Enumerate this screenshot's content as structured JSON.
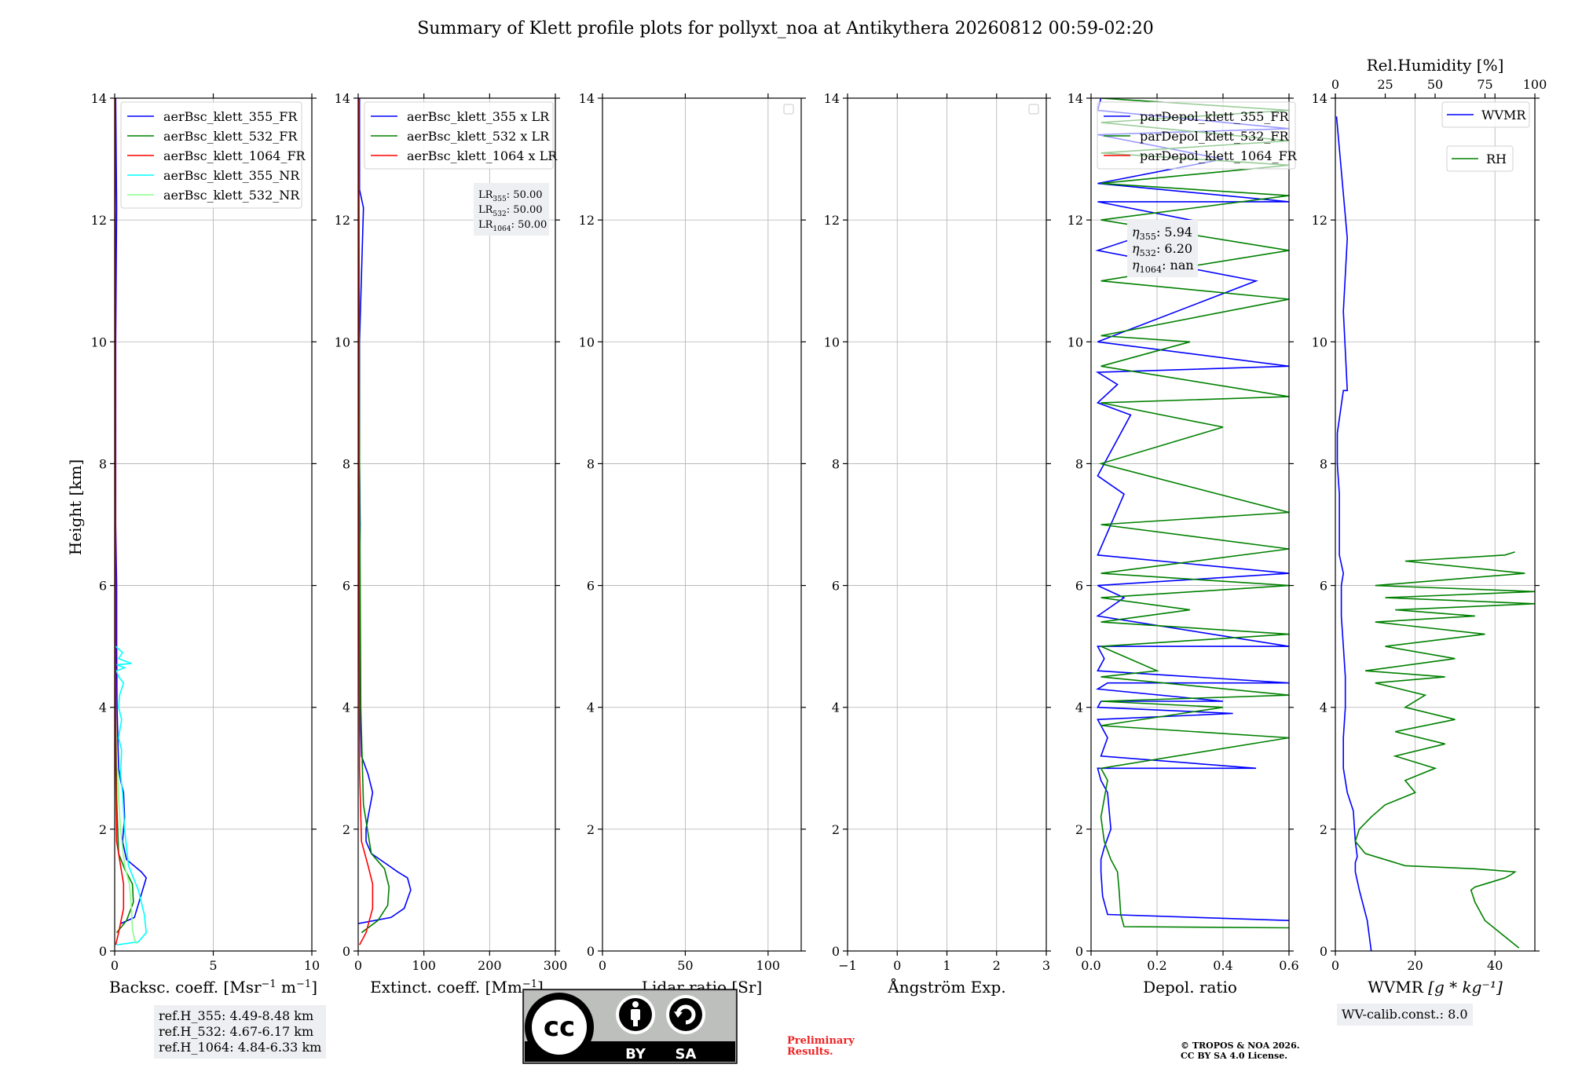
{
  "title": "Summary of Klett profile plots for pollyxt_noa at Antikythera 20260812 00:59-02:20",
  "shared_ylabel": "Height [km]",
  "chart_data": [
    {
      "type": "line",
      "id": "backscatter",
      "xlabel_parts": [
        "Backsc. coeff. [Msr",
        "−1",
        " m",
        "−1",
        "]"
      ],
      "xlim": [
        0,
        10
      ],
      "xticks": [
        0,
        5,
        10
      ],
      "ylim": [
        0,
        14
      ],
      "yticks": [
        0,
        2,
        4,
        6,
        8,
        10,
        12,
        14
      ],
      "grid": true,
      "legend_position": "top-left",
      "series": [
        {
          "name": "aerBsc_klett_355_FR",
          "color": "#0000ff",
          "x": [
            0.3,
            1.0,
            1.6,
            1.35,
            0.6,
            0.4,
            0.5,
            0.45,
            0.3,
            0.2,
            0.12,
            0.1,
            0.1,
            0.05,
            0.05,
            0.05,
            0.1,
            0.05
          ],
          "y": [
            0.45,
            0.55,
            1.2,
            1.3,
            1.5,
            1.8,
            2.2,
            2.6,
            2.8,
            3.0,
            4.0,
            5.0,
            6.0,
            7.0,
            8.0,
            10.0,
            12.2,
            14.0
          ]
        },
        {
          "name": "aerBsc_klett_532_FR",
          "color": "#008000",
          "x": [
            0.1,
            0.6,
            0.95,
            0.9,
            0.5,
            0.2,
            0.1,
            0.05,
            0.03,
            0.02
          ],
          "y": [
            0.3,
            0.5,
            0.8,
            1.1,
            1.35,
            1.6,
            2.5,
            4.0,
            8.0,
            14.0
          ]
        },
        {
          "name": "aerBsc_klett_1064_FR",
          "color": "#ff0000",
          "x": [
            0.05,
            0.2,
            0.45,
            0.45,
            0.3,
            0.1,
            0.05,
            0.03,
            0.02
          ],
          "y": [
            0.1,
            0.3,
            0.7,
            1.1,
            1.4,
            1.8,
            3.0,
            8.0,
            14.0
          ]
        },
        {
          "name": "aerBsc_klett_355_NR",
          "color": "#00ffff",
          "x": [
            0.1,
            1.2,
            1.6,
            1.5,
            1.2,
            0.7,
            0.5,
            0.4,
            0.3,
            0.35,
            0.2,
            0.35,
            0.2,
            0.25,
            0.45,
            0.2,
            0.1,
            0.5,
            0.1,
            0.85,
            0.2,
            0.4,
            0.05
          ],
          "y": [
            0.1,
            0.15,
            0.3,
            0.6,
            1.0,
            1.4,
            2.0,
            2.6,
            2.9,
            3.3,
            3.5,
            3.8,
            4.0,
            4.2,
            4.4,
            4.5,
            4.6,
            4.65,
            4.7,
            4.72,
            4.8,
            4.9,
            5.0
          ]
        },
        {
          "name": "aerBsc_klett_532_NR",
          "color": "#88ff88",
          "x": [
            1.1,
            1.0,
            0.9,
            0.85,
            0.75,
            0.5,
            0.3,
            0.2,
            0.15
          ],
          "y": [
            0.12,
            0.2,
            0.35,
            0.7,
            1.1,
            1.4,
            2.0,
            2.5,
            3.0
          ]
        }
      ],
      "annotation": [
        "ref.H_355: 4.49-8.48 km",
        "ref.H_532: 4.67-6.17 km",
        "ref.H_1064: 4.84-6.33 km"
      ]
    },
    {
      "type": "line",
      "id": "extinction",
      "xlabel_parts": [
        "Extinct. coeff. [Mm",
        "−1",
        "]"
      ],
      "xlim": [
        0,
        300
      ],
      "xticks": [
        0,
        100,
        200,
        300
      ],
      "ylim": [
        0,
        14
      ],
      "yticks": [
        0,
        2,
        4,
        6,
        8,
        10,
        12,
        14
      ],
      "grid": true,
      "legend_position": "top-left",
      "series": [
        {
          "name": "aerBsc_klett_355 x LR",
          "color": "#0000ff",
          "x": [
            0,
            50,
            70,
            80,
            75,
            60,
            40,
            20,
            12,
            12,
            15,
            22,
            15,
            5,
            3,
            2,
            2,
            3,
            2,
            2,
            8,
            2,
            2
          ],
          "y": [
            0.45,
            0.55,
            0.7,
            1.0,
            1.2,
            1.3,
            1.45,
            1.6,
            1.8,
            2.0,
            2.2,
            2.6,
            2.9,
            3.2,
            4.0,
            5.0,
            6.0,
            7.0,
            8.0,
            10.0,
            12.2,
            12.5,
            14.0
          ]
        },
        {
          "name": "aerBsc_klett_532 x LR",
          "color": "#008000",
          "x": [
            5,
            30,
            45,
            47,
            40,
            20,
            8,
            4,
            2,
            1
          ],
          "y": [
            0.3,
            0.5,
            0.75,
            1.05,
            1.35,
            1.6,
            2.4,
            4.0,
            8.0,
            14.0
          ]
        },
        {
          "name": "aerBsc_klett_1064 x LR",
          "color": "#ff0000",
          "x": [
            2,
            12,
            22,
            22,
            15,
            5,
            2,
            1,
            1
          ],
          "y": [
            0.1,
            0.3,
            0.7,
            1.1,
            1.4,
            1.8,
            3.0,
            8.0,
            14.0
          ]
        }
      ],
      "annotation": [
        {
          "base": "LR",
          "sub": "355",
          "value": ": 50.00"
        },
        {
          "base": "LR",
          "sub": "532",
          "value": ": 50.00"
        },
        {
          "base": "LR",
          "sub": "1064",
          "value": ": 50.00"
        }
      ]
    },
    {
      "type": "line",
      "id": "lidar-ratio",
      "xlabel_parts": [
        "Lidar ratio [Sr]"
      ],
      "xlim": [
        0,
        120
      ],
      "xticks": [
        0,
        50,
        100
      ],
      "ylim": [
        0,
        14
      ],
      "yticks": [
        0,
        2,
        4,
        6,
        8,
        10,
        12,
        14
      ],
      "grid": true,
      "legend_position": "top-right",
      "series": []
    },
    {
      "type": "line",
      "id": "angstrom",
      "xlabel_parts": [
        "Ångström Exp."
      ],
      "xlim": [
        -1,
        3
      ],
      "xticks": [
        -1,
        0,
        1,
        2,
        3
      ],
      "ylim": [
        0,
        14
      ],
      "yticks": [
        0,
        2,
        4,
        6,
        8,
        10,
        12,
        14
      ],
      "grid": true,
      "legend_position": "top-right",
      "series": []
    },
    {
      "type": "line",
      "id": "depol",
      "xlabel_parts": [
        "Depol. ratio"
      ],
      "xlim": [
        0,
        0.6
      ],
      "xticks": [
        0.0,
        0.2,
        0.4,
        0.6
      ],
      "xtick_labels": [
        "0.0",
        "0.2",
        "0.4",
        "0.6"
      ],
      "ylim": [
        0,
        14
      ],
      "yticks": [
        0,
        2,
        4,
        6,
        8,
        10,
        12,
        14
      ],
      "grid": true,
      "legend_position": "top-left",
      "series": [
        {
          "name": "parDepol_klett_355_FR",
          "color": "#0000ff",
          "x": [
            0.6,
            0.05,
            0.035,
            0.03,
            0.03,
            0.04,
            0.06,
            0.05,
            0.03,
            0.02,
            0.5,
            0.03,
            0.05,
            0.02,
            0.43,
            0.02,
            0.03,
            0.4,
            0.02,
            0.05,
            0.6,
            0.02,
            0.04,
            0.02,
            0.6,
            0.02,
            0.1,
            0.02,
            0.6,
            0.02,
            0.1,
            0.02,
            0.12,
            0.02,
            0.08,
            0.02,
            0.6,
            0.02,
            0.5,
            0.02,
            0.3,
            0.02,
            0.6,
            0.02,
            0.4,
            0.02,
            0.6,
            0.02,
            0.03
          ],
          "y": [
            0.5,
            0.6,
            0.9,
            1.3,
            1.5,
            1.7,
            2.0,
            2.6,
            2.8,
            3.0,
            3.0,
            3.2,
            3.5,
            3.8,
            3.9,
            4.0,
            4.1,
            4.1,
            4.3,
            4.4,
            4.4,
            4.6,
            4.8,
            5.0,
            5.0,
            5.5,
            5.8,
            6.0,
            6.2,
            6.5,
            7.5,
            7.8,
            8.8,
            9.0,
            9.3,
            9.5,
            9.6,
            10.0,
            11.0,
            11.5,
            12.0,
            12.3,
            12.3,
            12.6,
            13.0,
            13.4,
            13.5,
            13.8,
            14.0
          ]
        },
        {
          "name": "parDepol_klett_532_FR",
          "color": "#008000",
          "x": [
            0.6,
            0.1,
            0.09,
            0.085,
            0.08,
            0.06,
            0.04,
            0.03,
            0.05,
            0.03,
            0.6,
            0.03,
            0.4,
            0.03,
            0.6,
            0.03,
            0.2,
            0.03,
            0.6,
            0.03,
            0.3,
            0.03,
            0.6,
            0.03,
            0.6,
            0.03,
            0.6,
            0.03,
            0.4,
            0.03,
            0.6,
            0.03,
            0.3,
            0.03,
            0.6,
            0.03,
            0.6,
            0.03,
            0.6,
            0.03,
            0.6,
            0.03,
            0.6,
            0.03,
            0.6,
            0.03
          ],
          "y": [
            0.38,
            0.4,
            0.6,
            1.0,
            1.3,
            1.5,
            1.8,
            2.2,
            2.8,
            3.0,
            3.5,
            3.7,
            4.0,
            4.1,
            4.2,
            4.5,
            4.6,
            5.0,
            5.2,
            5.4,
            5.6,
            5.8,
            6.0,
            6.2,
            6.6,
            7.0,
            7.2,
            8.0,
            8.6,
            9.0,
            9.1,
            9.6,
            10.0,
            10.1,
            10.7,
            11.0,
            11.5,
            12.0,
            12.4,
            12.6,
            12.9,
            13.1,
            13.3,
            13.6,
            13.8,
            14.0
          ]
        },
        {
          "name": "parDepol_klett_1064_FR",
          "color": "#ff0000",
          "x": [],
          "y": []
        }
      ],
      "annotation": [
        {
          "base": "η",
          "sub": "355",
          "value": ": 5.94"
        },
        {
          "base": "η",
          "sub": "532",
          "value": ": 6.20"
        },
        {
          "base": "η",
          "sub": "1064",
          "value": ": nan"
        }
      ]
    },
    {
      "type": "line",
      "id": "wvmr",
      "xlabel": "WVMR",
      "xlabel_unit": "[g * kg⁻¹]",
      "xlim": [
        0,
        50
      ],
      "xticks": [
        0,
        20,
        40
      ],
      "ylim": [
        0,
        14
      ],
      "yticks": [
        0,
        2,
        4,
        6,
        8,
        10,
        12,
        14
      ],
      "grid": true,
      "top_axis": {
        "label": "Rel.Humidity [%]",
        "lim": [
          0,
          100
        ],
        "ticks": [
          0,
          25,
          50,
          75,
          100
        ]
      },
      "series": [
        {
          "name": "WVMR",
          "color": "#0000ff",
          "axis": "bottom",
          "x": [
            9,
            8,
            6,
            5,
            5,
            5.5,
            5,
            4.5,
            3,
            2,
            2,
            2.5,
            2.5,
            2,
            1.5,
            1.5,
            2,
            1,
            1,
            1,
            0.5,
            0.5,
            0.5,
            2,
            3,
            2,
            3,
            0.3
          ],
          "y": [
            0.0,
            0.5,
            1.0,
            1.3,
            1.45,
            1.55,
            1.8,
            2.3,
            2.6,
            3.0,
            3.5,
            4.0,
            4.5,
            5.0,
            5.5,
            6.0,
            6.2,
            6.5,
            7.0,
            7.5,
            8.0,
            8.1,
            8.5,
            9.2,
            9.2,
            10.5,
            11.7,
            13.7
          ]
        },
        {
          "name": "RH",
          "color": "#008000",
          "axis": "top",
          "x": [
            92,
            75,
            70,
            68,
            70,
            75,
            80,
            85,
            88,
            90,
            70,
            35,
            15,
            10,
            12,
            18,
            25,
            40,
            35,
            50,
            30,
            55,
            30,
            60,
            35,
            45,
            20,
            55,
            15,
            60,
            25,
            75,
            20,
            70,
            30,
            100,
            25,
            100,
            20,
            95,
            35,
            85,
            90
          ],
          "y": [
            0.05,
            0.5,
            0.8,
            1.0,
            1.05,
            1.1,
            1.15,
            1.2,
            1.25,
            1.3,
            1.35,
            1.4,
            1.6,
            1.8,
            2.0,
            2.2,
            2.4,
            2.6,
            2.8,
            3.0,
            3.2,
            3.4,
            3.6,
            3.8,
            4.0,
            4.2,
            4.4,
            4.5,
            4.6,
            4.8,
            5.0,
            5.2,
            5.4,
            5.5,
            5.6,
            5.7,
            5.8,
            5.9,
            6.0,
            6.2,
            6.4,
            6.5,
            6.55
          ]
        }
      ],
      "legend": [
        "WVMR",
        "RH"
      ],
      "annotation": [
        "WV-calib.const.: 8.0"
      ]
    }
  ],
  "license_logo": {
    "icon": "cc-by-sa-icon",
    "by_label": "BY",
    "sa_label": "SA",
    "cc_label": "cc"
  },
  "preliminary": [
    "Preliminary",
    "Results."
  ],
  "copyright": [
    "© TROPOS & NOA 2026.",
    "CC BY SA 4.0 License."
  ],
  "colors": {
    "blue": "#0000ff",
    "green": "#008000",
    "red": "#ff0000",
    "cyan": "#00ffff",
    "lightgreen": "#88ff88",
    "grid": "#b0b0b0",
    "legend_box": "#eeeff2"
  }
}
